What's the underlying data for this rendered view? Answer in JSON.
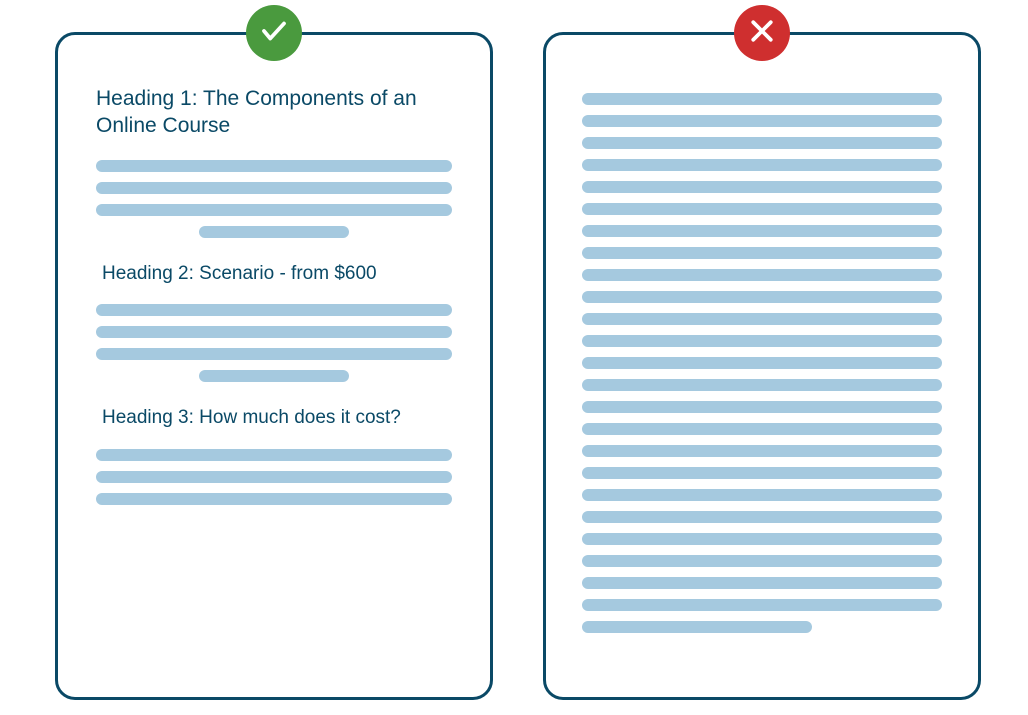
{
  "good": {
    "heading1": "Heading 1: The Components of an Online Course",
    "heading2": "Heading 2: Scenario - from $600",
    "heading3": "Heading 3: How much does it cost?",
    "icon": "check-icon",
    "badge_color": "#4a9a3e"
  },
  "bad": {
    "icon": "cross-icon",
    "badge_color": "#cf2f2f",
    "line_count": 24
  },
  "colors": {
    "border": "#0a4966",
    "heading_text": "#0a4966",
    "placeholder_line": "#a5c9df"
  }
}
